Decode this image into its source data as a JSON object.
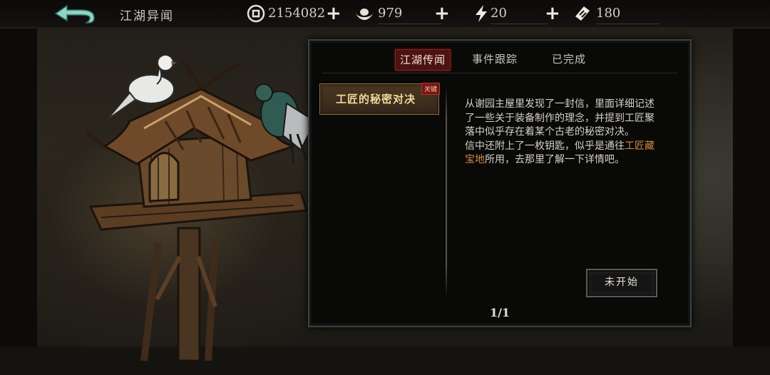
{
  "header": {
    "title": "江湖异闻",
    "coins": "2154082",
    "silver": "979",
    "stamina": "20",
    "tickets": "180",
    "plus_glyph": "+"
  },
  "tabs": [
    {
      "label": "江湖传闻",
      "active": true
    },
    {
      "label": "事件跟踪",
      "active": false
    },
    {
      "label": "已完成",
      "active": false
    }
  ],
  "quest": {
    "title": "工匠的秘密对决",
    "tag": "关键"
  },
  "description": {
    "line1": "从谢园主屋里发现了一封信，里面详细记述了一些关于装备制作的理念，并提到工匠聚落中似乎存在着某个古老的秘密对决。",
    "line2_pre": "信中还附上了一枚钥匙，似乎是通往",
    "line2_highlight": "工匠藏宝地",
    "line2_post": "所用，去那里了解一下详情吧。"
  },
  "action_button": "未开始",
  "pager": "1/1",
  "colors": {
    "accent_tab": "#4e1212",
    "highlight_text": "#d58a3e",
    "quest_gold": "#f1d79a"
  },
  "icons": [
    "back-arrow-icon",
    "coin-icon",
    "silver-ingot-icon",
    "lightning-icon",
    "ticket-icon",
    "plus-icon"
  ]
}
